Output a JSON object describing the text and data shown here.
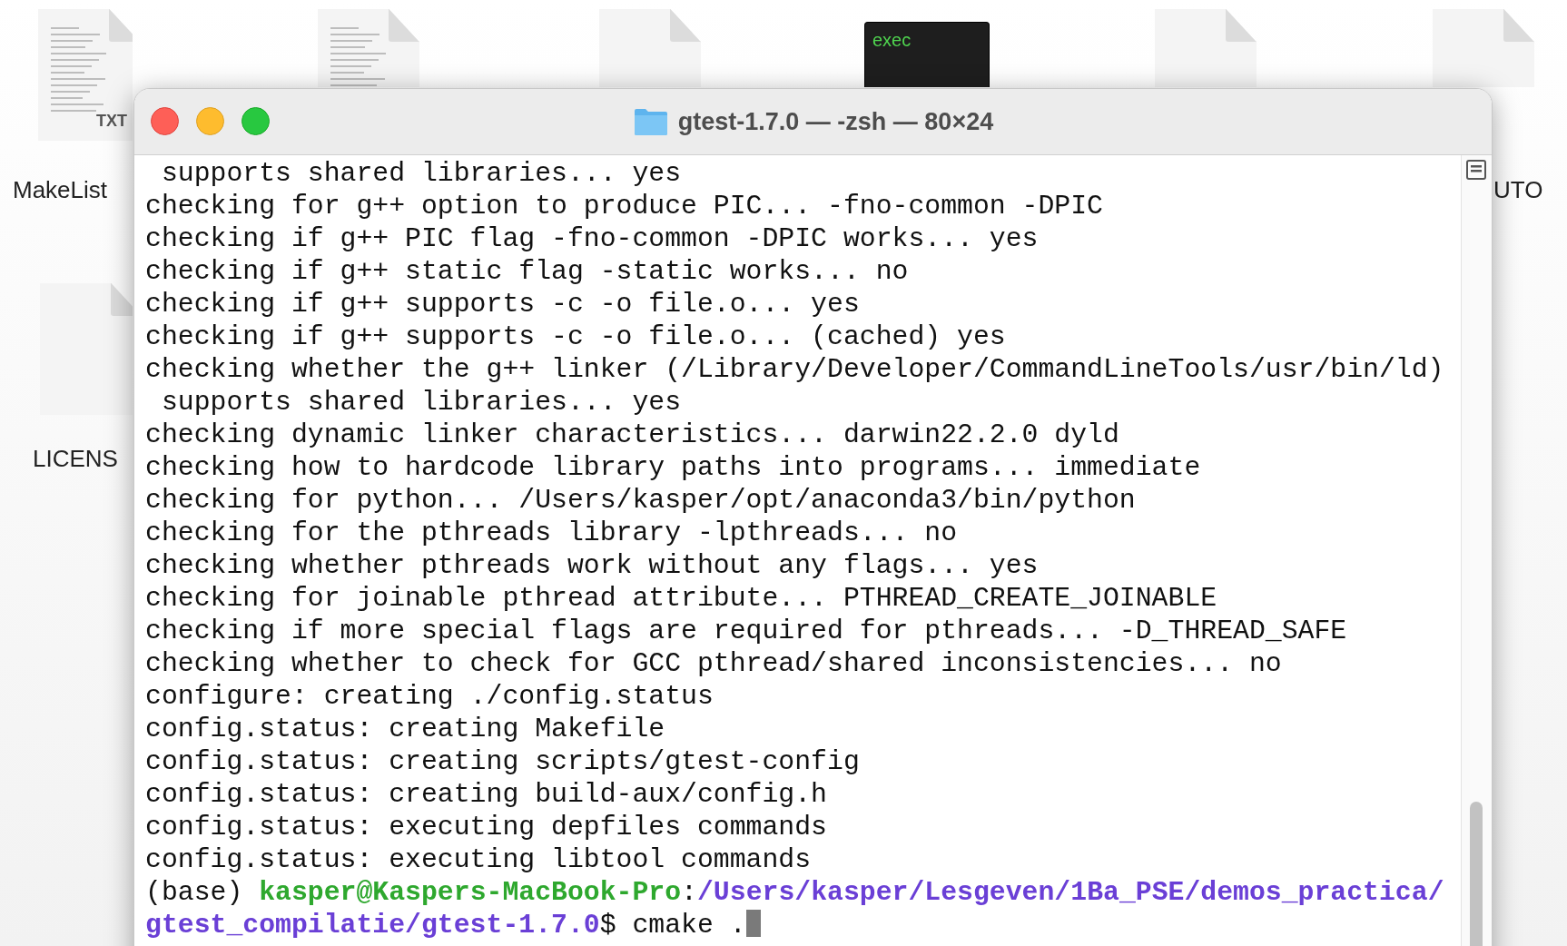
{
  "desktop_icons": [
    {
      "kind": "text-document",
      "badge": "TXT",
      "label": "MakeList"
    },
    {
      "kind": "document"
    },
    {
      "kind": "blank"
    },
    {
      "kind": "executable",
      "badge": "exec"
    },
    {
      "kind": "blank"
    },
    {
      "kind": "blank",
      "label": "UTO"
    },
    {
      "kind": "blank",
      "label": "LICENS"
    }
  ],
  "window": {
    "title": "gtest-1.7.0 — -zsh — 80×24",
    "lines": [
      " supports shared libraries... yes",
      "checking for g++ option to produce PIC... -fno-common -DPIC",
      "checking if g++ PIC flag -fno-common -DPIC works... yes",
      "checking if g++ static flag -static works... no",
      "checking if g++ supports -c -o file.o... yes",
      "checking if g++ supports -c -o file.o... (cached) yes",
      "checking whether the g++ linker (/Library/Developer/CommandLineTools/usr/bin/ld)",
      " supports shared libraries... yes",
      "checking dynamic linker characteristics... darwin22.2.0 dyld",
      "checking how to hardcode library paths into programs... immediate",
      "checking for python... /Users/kasper/opt/anaconda3/bin/python",
      "checking for the pthreads library -lpthreads... no",
      "checking whether pthreads work without any flags... yes",
      "checking for joinable pthread attribute... PTHREAD_CREATE_JOINABLE",
      "checking if more special flags are required for pthreads... -D_THREAD_SAFE",
      "checking whether to check for GCC pthread/shared inconsistencies... no",
      "configure: creating ./config.status",
      "config.status: creating Makefile",
      "config.status: creating scripts/gtest-config",
      "config.status: creating build-aux/config.h",
      "config.status: executing depfiles commands",
      "config.status: executing libtool commands"
    ],
    "prompt": {
      "env": "(base) ",
      "user_host": "kasper@Kaspers-MacBook-Pro",
      "separator": ":",
      "path": "/Users/kasper/Lesgeven/1Ba_PSE/demos_practica/gtest_compilatie/gtest-1.7.0",
      "symbol": "$ ",
      "command": "cmake ."
    }
  }
}
